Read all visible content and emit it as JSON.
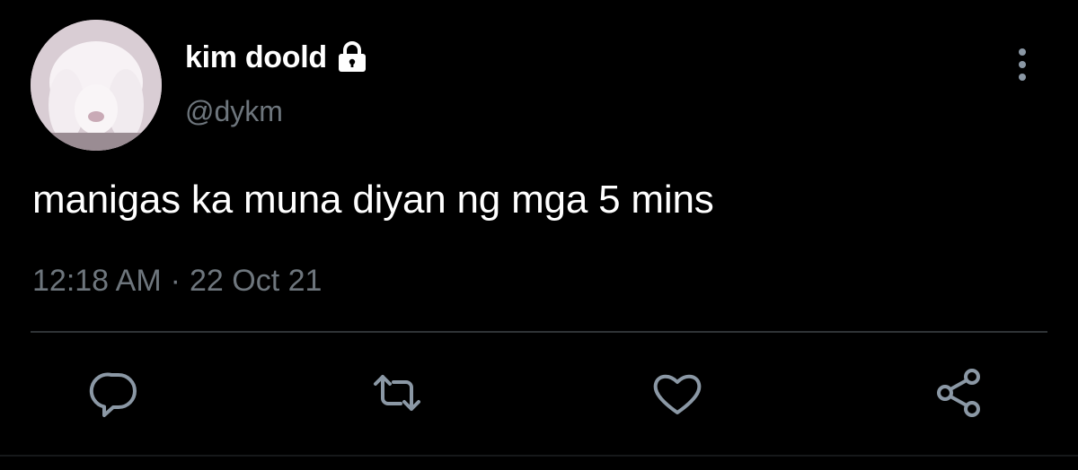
{
  "tweet": {
    "author": {
      "display_name": "kim doold",
      "handle": "@dykm",
      "avatar_icon": "bunny-avatar",
      "protected_icon": "lock-icon"
    },
    "text": "manigas ka muna diyan ng mga 5 mins",
    "time": "12:18 AM",
    "separator": "·",
    "date": "22 Oct 21",
    "more_icon": "more-vertical-icon"
  },
  "actions": [
    {
      "name": "reply",
      "icon": "reply-icon"
    },
    {
      "name": "retweet",
      "icon": "retweet-icon"
    },
    {
      "name": "like",
      "icon": "heart-icon"
    },
    {
      "name": "share",
      "icon": "share-icon"
    }
  ],
  "colors": {
    "background": "#000000",
    "primary_text": "#ffffff",
    "secondary_text": "#6e767d",
    "icon": "#8b98a5",
    "divider": "#2f3336"
  }
}
